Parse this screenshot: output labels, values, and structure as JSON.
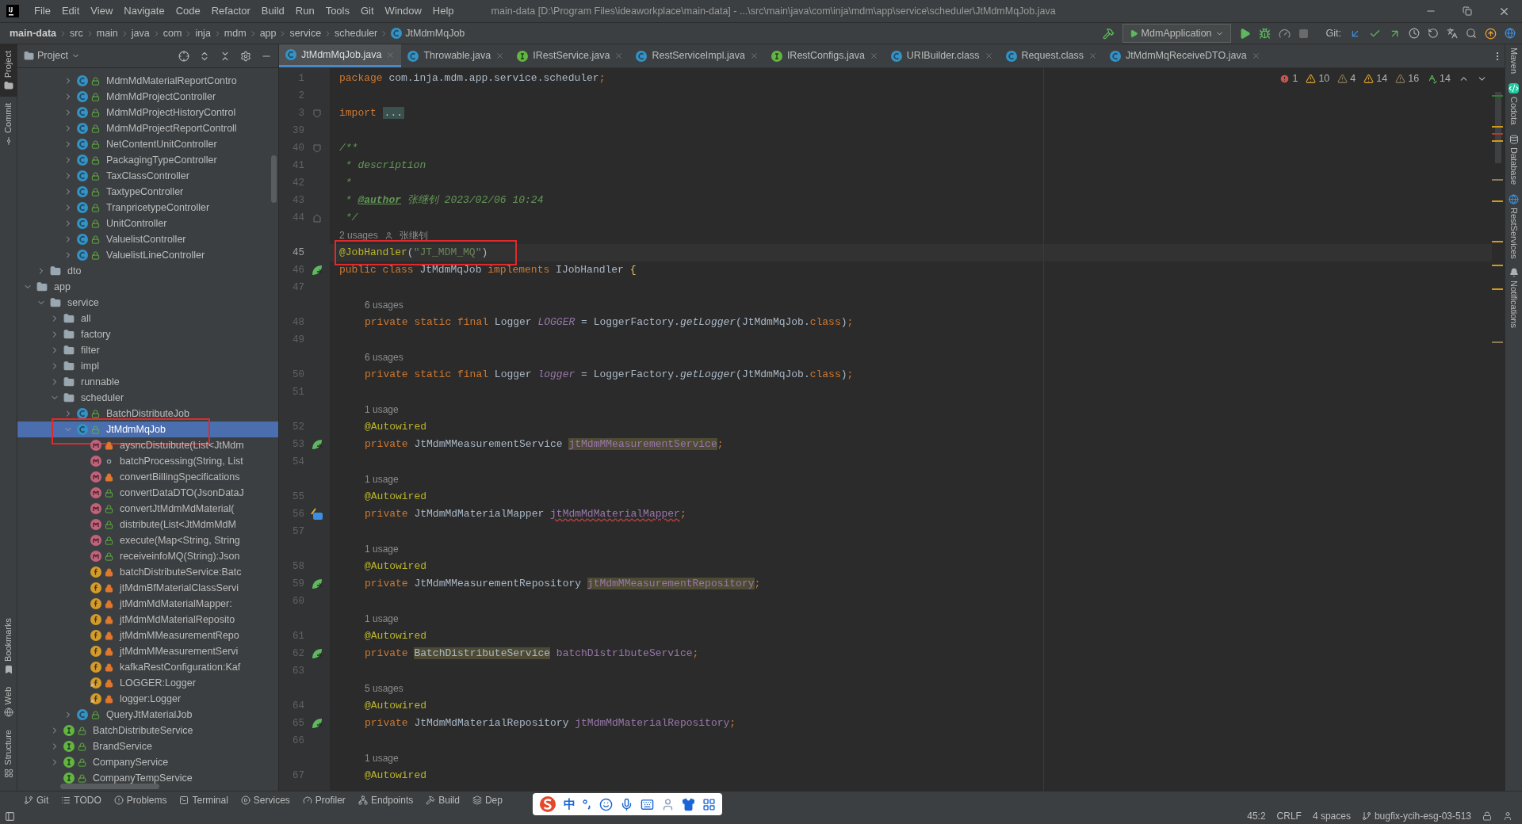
{
  "menu": [
    "File",
    "Edit",
    "View",
    "Navigate",
    "Code",
    "Refactor",
    "Build",
    "Run",
    "Tools",
    "Git",
    "Window",
    "Help"
  ],
  "window": {
    "title": "main-data [D:\\Program Files\\ideaworkplace\\main-data] - ...\\src\\main\\java\\com\\inja\\mdm\\app\\service\\scheduler\\JtMdmMqJob.java"
  },
  "breadcrumbs": [
    {
      "label": "main-data",
      "kind": "project"
    },
    {
      "label": "src",
      "kind": "folder"
    },
    {
      "label": "main",
      "kind": "folder"
    },
    {
      "label": "java",
      "kind": "folder"
    },
    {
      "label": "com",
      "kind": "folder"
    },
    {
      "label": "inja",
      "kind": "folder"
    },
    {
      "label": "mdm",
      "kind": "folder"
    },
    {
      "label": "app",
      "kind": "folder"
    },
    {
      "label": "service",
      "kind": "folder"
    },
    {
      "label": "scheduler",
      "kind": "folder"
    },
    {
      "label": "JtMdmMqJob",
      "kind": "class"
    }
  ],
  "run_config": "MdmApplication",
  "git_label": "Git:",
  "project_panel": {
    "title": "Project",
    "tree": [
      {
        "children": [
          {
            "children": [
              {
                "children": [
                  {
                    "label": "MdmMdMaterialReportContro",
                    "kind": "class",
                    "modifier": {
                      "kind": "public"
                    },
                    "expanded": false,
                    "selected": false
                  },
                  {
                    "label": "MdmMdProjectController",
                    "kind": "class",
                    "modifier": {
                      "kind": "public"
                    },
                    "expanded": false,
                    "selected": false
                  },
                  {
                    "label": "MdmMdProjectHistoryControl",
                    "kind": "class",
                    "modifier": {
                      "kind": "public"
                    },
                    "expanded": false,
                    "selected": false
                  },
                  {
                    "label": "MdmMdProjectReportControll",
                    "kind": "class",
                    "modifier": {
                      "kind": "public"
                    },
                    "expanded": false,
                    "selected": false
                  },
                  {
                    "label": "NetContentUnitController",
                    "kind": "class",
                    "modifier": {
                      "kind": "public"
                    },
                    "expanded": false,
                    "selected": false
                  },
                  {
                    "label": "PackagingTypeController",
                    "kind": "class",
                    "modifier": {
                      "kind": "public"
                    },
                    "expanded": false,
                    "selected": false
                  },
                  {
                    "label": "TaxClassController",
                    "kind": "class",
                    "modifier": {
                      "kind": "public"
                    },
                    "expanded": false,
                    "selected": false
                  },
                  {
                    "label": "TaxtypeController",
                    "kind": "class",
                    "modifier": {
                      "kind": "public"
                    },
                    "expanded": false,
                    "selected": false
                  },
                  {
                    "label": "TranpricetypeController",
                    "kind": "class",
                    "modifier": {
                      "kind": "public"
                    },
                    "expanded": false,
                    "selected": false
                  },
                  {
                    "label": "UnitController",
                    "kind": "class",
                    "modifier": {
                      "kind": "public"
                    },
                    "expanded": false,
                    "selected": false
                  },
                  {
                    "label": "ValuelistController",
                    "kind": "class",
                    "modifier": {
                      "kind": "public"
                    },
                    "expanded": false,
                    "selected": false
                  },
                  {
                    "label": "ValuelistLineController",
                    "kind": "class",
                    "modifier": {
                      "kind": "public"
                    },
                    "expanded": false,
                    "selected": false
                  }
                ]
              }
            ]
          },
          {
            "label": "dto",
            "kind": "folder",
            "expanded": false,
            "selected": false
          }
        ]
      },
      {
        "label": "app",
        "kind": "folder",
        "expanded": true,
        "selected": false,
        "children": [
          {
            "label": "service",
            "kind": "folder",
            "expanded": true,
            "selected": false,
            "children": [
              {
                "label": "all",
                "kind": "folder",
                "expanded": false,
                "selected": false
              },
              {
                "label": "factory",
                "kind": "folder",
                "expanded": false,
                "selected": false
              },
              {
                "label": "filter",
                "kind": "folder",
                "expanded": false,
                "selected": false
              },
              {
                "label": "impl",
                "kind": "folder",
                "expanded": false,
                "selected": false
              },
              {
                "label": "runnable",
                "kind": "folder",
                "expanded": false,
                "selected": false
              },
              {
                "label": "scheduler",
                "kind": "folder",
                "expanded": true,
                "selected": false,
                "children": [
                  {
                    "label": "BatchDistributeJob",
                    "kind": "class",
                    "modifier": {
                      "kind": "public"
                    },
                    "expanded": false,
                    "selected": false
                  },
                  {
                    "label": "JtMdmMqJob",
                    "kind": "class",
                    "modifier": {
                      "kind": "public"
                    },
                    "expanded": true,
                    "selected": true,
                    "marked": true,
                    "children": [
                      {
                        "label": "aysncDistuibute(List<JtMdm",
                        "kind": "method",
                        "modifier": {
                          "kind": "private"
                        },
                        "selected": false
                      },
                      {
                        "label": "batchProcessing(String, List",
                        "kind": "method",
                        "modifier": {
                          "kind": "package"
                        },
                        "selected": false
                      },
                      {
                        "label": "convertBillingSpecifications",
                        "kind": "method",
                        "modifier": {
                          "kind": "private"
                        },
                        "selected": false
                      },
                      {
                        "label": "convertDataDTO(JsonDataJ",
                        "kind": "method",
                        "modifier": {
                          "kind": "public"
                        },
                        "selected": false
                      },
                      {
                        "label": "convertJtMdmMdMaterial(",
                        "kind": "method",
                        "modifier": {
                          "kind": "public"
                        },
                        "selected": false
                      },
                      {
                        "label": "distribute(List<JtMdmMdM",
                        "kind": "method",
                        "modifier": {
                          "kind": "public"
                        },
                        "selected": false
                      },
                      {
                        "label": "execute(Map<String, String",
                        "kind": "method",
                        "modifier": {
                          "kind": "public"
                        },
                        "selected": false
                      },
                      {
                        "label": "receiveinfoMQ(String):Json",
                        "kind": "method",
                        "modifier": {
                          "kind": "public"
                        },
                        "selected": false
                      },
                      {
                        "label": "batchDistributeService:Batc",
                        "kind": "field",
                        "modifier": {
                          "kind": "private"
                        },
                        "selected": false
                      },
                      {
                        "label": "jtMdmBfMaterialClassServi",
                        "kind": "field",
                        "modifier": {
                          "kind": "private"
                        },
                        "selected": false
                      },
                      {
                        "label": "jtMdmMdMaterialMapper:",
                        "kind": "field",
                        "modifier": {
                          "kind": "private"
                        },
                        "selected": false
                      },
                      {
                        "label": "jtMdmMdMaterialReposito",
                        "kind": "field",
                        "modifier": {
                          "kind": "private"
                        },
                        "selected": false
                      },
                      {
                        "label": "jtMdmMMeasurementRepo",
                        "kind": "field",
                        "modifier": {
                          "kind": "private"
                        },
                        "selected": false
                      },
                      {
                        "label": "jtMdmMMeasurementServi",
                        "kind": "field",
                        "modifier": {
                          "kind": "private"
                        },
                        "selected": false
                      },
                      {
                        "label": "kafkaRestConfiguration:Kaf",
                        "kind": "field",
                        "modifier": {
                          "kind": "private"
                        },
                        "selected": false
                      },
                      {
                        "label": "LOGGER:Logger",
                        "kind": "static_field",
                        "modifier": {
                          "kind": "private"
                        },
                        "selected": false
                      },
                      {
                        "label": "logger:Logger",
                        "kind": "static_field",
                        "modifier": {
                          "kind": "private"
                        },
                        "selected": false
                      }
                    ]
                  },
                  {
                    "label": "QueryJtMaterialJob",
                    "kind": "class",
                    "modifier": {
                      "kind": "public"
                    },
                    "expanded": false,
                    "selected": false
                  }
                ]
              },
              {
                "label": "BatchDistributeService",
                "kind": "interface",
                "modifier": {
                  "kind": "public"
                },
                "expanded": false,
                "selected": false
              },
              {
                "label": "BrandService",
                "kind": "interface",
                "modifier": {
                  "kind": "public"
                },
                "expanded": false,
                "selected": false
              },
              {
                "label": "CompanyService",
                "kind": "interface",
                "modifier": {
                  "kind": "public"
                },
                "expanded": false,
                "selected": false
              },
              {
                "label": "CompanyTempService",
                "kind": "interface",
                "modifier": {
                  "kind": "public"
                },
                "selected": false
              }
            ]
          }
        ]
      }
    ]
  },
  "tabs": [
    {
      "label": "JtMdmMqJob.java",
      "kind": "class",
      "selected": true
    },
    {
      "label": "Throwable.java",
      "kind": "class",
      "selected": false
    },
    {
      "label": "IRestService.java",
      "kind": "interface",
      "selected": false
    },
    {
      "label": "RestServiceImpl.java",
      "kind": "class",
      "selected": false
    },
    {
      "label": "IRestConfigs.java",
      "kind": "interface",
      "selected": false
    },
    {
      "label": "URIBuilder.class",
      "kind": "class",
      "selected": false
    },
    {
      "label": "Request.class",
      "kind": "class",
      "selected": false
    },
    {
      "label": "JtMdmMqReceiveDTO.java",
      "kind": "class",
      "selected": false
    }
  ],
  "inspections": [
    {
      "kind": "error",
      "count": "1"
    },
    {
      "kind": "warning",
      "count": "10"
    },
    {
      "kind": "weak_warning",
      "count": "4"
    },
    {
      "kind": "warning",
      "count": "14"
    },
    {
      "kind": "weak_warning",
      "count": "16"
    },
    {
      "kind": "typo",
      "count": "14"
    }
  ],
  "editor": {
    "rows": [
      {
        "kind": "code",
        "number": "1",
        "tokens": [
          {
            "kind": "kw",
            "text": "package"
          },
          {
            "kind": "plain",
            "text": " com.inja.mdm.app.service.scheduler"
          },
          {
            "kind": "kw",
            "text": ";"
          }
        ]
      },
      {
        "kind": "code",
        "number": "2",
        "tokens": []
      },
      {
        "kind": "code",
        "number": "3",
        "gutter": {
          "kind": "fold_open"
        },
        "tokens": [
          {
            "kind": "kw",
            "text": "import "
          },
          {
            "kind": "folded",
            "text": "..."
          }
        ]
      },
      {
        "kind": "code",
        "number": "39",
        "tokens": []
      },
      {
        "kind": "code",
        "number": "40",
        "gutter": {
          "kind": "fold_open"
        },
        "tokens": [
          {
            "kind": "doc",
            "text": "/**"
          }
        ]
      },
      {
        "kind": "code",
        "number": "41",
        "tokens": [
          {
            "kind": "doc",
            "text": " * description"
          }
        ]
      },
      {
        "kind": "code",
        "number": "42",
        "tokens": [
          {
            "kind": "doc",
            "text": " *"
          }
        ]
      },
      {
        "kind": "code",
        "number": "43",
        "tokens": [
          {
            "kind": "doc",
            "text": " * "
          },
          {
            "kind": "doctag",
            "text": "@author"
          },
          {
            "kind": "doc",
            "text": " 张继钊 2023/02/06 10:24"
          }
        ]
      },
      {
        "kind": "code",
        "number": "44",
        "gutter": {
          "kind": "fold_end"
        },
        "tokens": [
          {
            "kind": "doc",
            "text": " */"
          }
        ]
      },
      {
        "kind": "hint",
        "text": "2 usages",
        "author": "张继钊"
      },
      {
        "kind": "code",
        "number": "45",
        "current": true,
        "marked": true,
        "tokens": [
          {
            "kind": "annotation",
            "text": "@JobHandler"
          },
          {
            "kind": "plain",
            "text": "("
          },
          {
            "kind": "string",
            "text": "\"JT_MDM_MQ\""
          },
          {
            "kind": "plain",
            "text": ")"
          }
        ]
      },
      {
        "kind": "code",
        "number": "46",
        "gutter": {
          "kind": "bean"
        },
        "tokens": [
          {
            "kind": "kw",
            "text": "public class "
          },
          {
            "kind": "plain",
            "text": "JtMdmMqJob "
          },
          {
            "kind": "kw",
            "text": "implements "
          },
          {
            "kind": "plain",
            "text": "IJobHandler "
          },
          {
            "kind": "brace",
            "text": "{"
          }
        ]
      },
      {
        "kind": "code",
        "number": "47",
        "tokens": []
      },
      {
        "kind": "hint",
        "text": "6 usages",
        "indented": true
      },
      {
        "kind": "code",
        "number": "48",
        "indented": true,
        "tokens": [
          {
            "kind": "kw",
            "text": "private static final "
          },
          {
            "kind": "plain",
            "text": "Logger "
          },
          {
            "kind": "static",
            "text": "LOGGER"
          },
          {
            "kind": "plain",
            "text": " = LoggerFactory."
          },
          {
            "kind": "smethod",
            "text": "getLogger"
          },
          {
            "kind": "plain",
            "text": "(JtMdmMqJob."
          },
          {
            "kind": "kw",
            "text": "class"
          },
          {
            "kind": "plain",
            "text": ")"
          },
          {
            "kind": "kw",
            "text": ";"
          }
        ]
      },
      {
        "kind": "code",
        "number": "49",
        "tokens": []
      },
      {
        "kind": "hint",
        "text": "6 usages",
        "indented": true
      },
      {
        "kind": "code",
        "number": "50",
        "indented": true,
        "tokens": [
          {
            "kind": "kw",
            "text": "private static final "
          },
          {
            "kind": "plain",
            "text": "Logger "
          },
          {
            "kind": "static",
            "text": "logger"
          },
          {
            "kind": "plain",
            "text": " = LoggerFactory."
          },
          {
            "kind": "smethod",
            "text": "getLogger"
          },
          {
            "kind": "plain",
            "text": "(JtMdmMqJob."
          },
          {
            "kind": "kw",
            "text": "class"
          },
          {
            "kind": "plain",
            "text": ")"
          },
          {
            "kind": "kw",
            "text": ";"
          }
        ]
      },
      {
        "kind": "code",
        "number": "51",
        "tokens": []
      },
      {
        "kind": "hint",
        "text": "1 usage",
        "indented": true
      },
      {
        "kind": "code",
        "number": "52",
        "indented": true,
        "tokens": [
          {
            "kind": "annotation",
            "text": "@Autowired"
          }
        ]
      },
      {
        "kind": "code",
        "number": "53",
        "indented": true,
        "gutter": {
          "kind": "bean"
        },
        "tokens": [
          {
            "kind": "kw",
            "text": "private "
          },
          {
            "kind": "plain",
            "text": "JtMdmMMeasurementService "
          },
          {
            "kind": "field_hl",
            "text": "jtMdmMMeasurementService"
          },
          {
            "kind": "kw",
            "text": ";"
          }
        ]
      },
      {
        "kind": "code",
        "number": "54",
        "tokens": []
      },
      {
        "kind": "hint",
        "text": "1 usage",
        "indented": true
      },
      {
        "kind": "code",
        "number": "55",
        "indented": true,
        "tokens": [
          {
            "kind": "annotation",
            "text": "@Autowired"
          }
        ]
      },
      {
        "kind": "code",
        "number": "56",
        "indented": true,
        "gutter": {
          "kind": "mapper"
        },
        "tokens": [
          {
            "kind": "kw",
            "text": "private "
          },
          {
            "kind": "plain",
            "text": "JtMdmMdMaterialMapper "
          },
          {
            "kind": "field_err",
            "text": "jtMdmMdMaterialMapper"
          },
          {
            "kind": "kw",
            "text": ";"
          }
        ]
      },
      {
        "kind": "code",
        "number": "57",
        "tokens": []
      },
      {
        "kind": "hint",
        "text": "1 usage",
        "indented": true
      },
      {
        "kind": "code",
        "number": "58",
        "indented": true,
        "tokens": [
          {
            "kind": "annotation",
            "text": "@Autowired"
          }
        ]
      },
      {
        "kind": "code",
        "number": "59",
        "indented": true,
        "gutter": {
          "kind": "bean"
        },
        "tokens": [
          {
            "kind": "kw",
            "text": "private "
          },
          {
            "kind": "plain",
            "text": "JtMdmMMeasurementRepository "
          },
          {
            "kind": "field_hl",
            "text": "jtMdmMMeasurementRepository"
          },
          {
            "kind": "kw",
            "text": ";"
          }
        ]
      },
      {
        "kind": "code",
        "number": "60",
        "tokens": []
      },
      {
        "kind": "hint",
        "text": "1 usage",
        "indented": true
      },
      {
        "kind": "code",
        "number": "61",
        "indented": true,
        "tokens": [
          {
            "kind": "annotation",
            "text": "@Autowired"
          }
        ]
      },
      {
        "kind": "code",
        "number": "62",
        "indented": true,
        "gutter": {
          "kind": "bean"
        },
        "tokens": [
          {
            "kind": "kw",
            "text": "private "
          },
          {
            "kind": "type_hl",
            "text": "BatchDistributeService"
          },
          {
            "kind": "field",
            "text": " batchDistributeService"
          },
          {
            "kind": "kw",
            "text": ";"
          }
        ]
      },
      {
        "kind": "code",
        "number": "63",
        "tokens": []
      },
      {
        "kind": "hint",
        "text": "5 usages",
        "indented": true
      },
      {
        "kind": "code",
        "number": "64",
        "indented": true,
        "tokens": [
          {
            "kind": "annotation",
            "text": "@Autowired"
          }
        ]
      },
      {
        "kind": "code",
        "number": "65",
        "indented": true,
        "gutter": {
          "kind": "bean"
        },
        "tokens": [
          {
            "kind": "kw",
            "text": "private "
          },
          {
            "kind": "plain",
            "text": "JtMdmMdMaterialRepository "
          },
          {
            "kind": "field",
            "text": "jtMdmMdMaterialRepository"
          },
          {
            "kind": "kw",
            "text": ";"
          }
        ]
      },
      {
        "kind": "code",
        "number": "66",
        "tokens": []
      },
      {
        "kind": "hint",
        "text": "1 usage",
        "indented": true
      },
      {
        "kind": "code",
        "number": "67",
        "indented": true,
        "tokens": [
          {
            "kind": "annotation",
            "text": "@Autowired"
          }
        ]
      }
    ]
  },
  "left_stripe_top": [
    {
      "label": "Project",
      "kind": "folder",
      "selected": true
    },
    {
      "label": "Commit",
      "kind": "commit",
      "selected": false
    }
  ],
  "left_stripe_bottom": [
    {
      "label": "Bookmarks",
      "kind": "bookmark",
      "selected": false
    },
    {
      "label": "Web",
      "kind": "web",
      "selected": false
    },
    {
      "label": "Structure",
      "kind": "structure",
      "selected": false
    }
  ],
  "right_stripe": [
    {
      "label": "Maven",
      "kind": "maven"
    },
    {
      "label": "Codota",
      "kind": "codota"
    },
    {
      "label": "Database",
      "kind": "database"
    },
    {
      "label": "RestServices",
      "kind": "rest"
    },
    {
      "label": "Notifications",
      "kind": "bell"
    }
  ],
  "tool_windows": [
    {
      "label": "Git",
      "kind": "git"
    },
    {
      "label": "TODO",
      "kind": "todo"
    },
    {
      "label": "Problems",
      "kind": "problems"
    },
    {
      "label": "Terminal",
      "kind": "terminal"
    },
    {
      "label": "Services",
      "kind": "services"
    },
    {
      "label": "Profiler",
      "kind": "profiler"
    },
    {
      "label": "Endpoints",
      "kind": "endpoints"
    },
    {
      "label": "Build",
      "kind": "build"
    },
    {
      "label": "Dep",
      "kind": "deps"
    }
  ],
  "input_method": {
    "mode": "中"
  },
  "status_bar": {
    "position": "45:2",
    "line_separator": "CRLF",
    "indent": "4 spaces",
    "branch": "bugfix-ycih-esg-03-513"
  }
}
